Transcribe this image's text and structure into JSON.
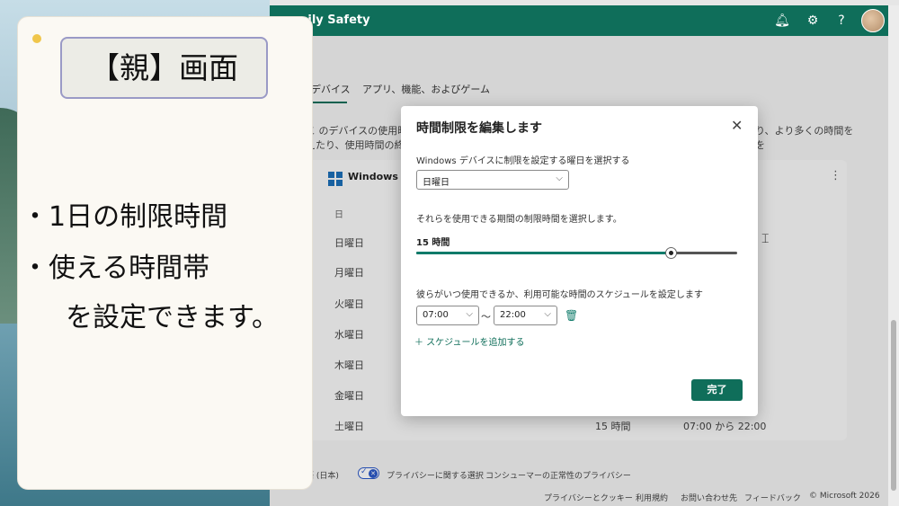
{
  "app": {
    "title": "Microsoft Family Safety",
    "title_visible": "...mily Safety",
    "accent_color": "#0f6e5a",
    "icons": [
      "bell-icon",
      "people-settings-icon",
      "help-icon",
      "avatar"
    ]
  },
  "tabs": [
    {
      "label": "デバイス",
      "active": true
    },
    {
      "label": "アプリ、機能、およびゲーム",
      "active": false
    }
  ],
  "description": {
    "left_line1": "こ のデバイスの使用時",
    "left_line2": "えたり、使用時間の終",
    "right_line1": "り、より多くの時間を",
    "right_line2": "を"
  },
  "device_card": {
    "device_name": "Windows デ",
    "day_header": "日",
    "days": [
      "日曜日",
      "月曜日",
      "火曜日",
      "水曜日",
      "木曜日",
      "金曜日",
      "土曜日"
    ],
    "saturday_hours": "15 時間",
    "saturday_range": "07:00 から 22:00"
  },
  "footer": {
    "locale": "語 (日本)",
    "privacy_choices": "プライバシーに関する選択",
    "consumer_health_privacy": "コンシューマーの正常性のプライバシー",
    "links": [
      "プライバシーとクッキー",
      "利用規約",
      "お問い合わせ先",
      "フィードバック",
      "© Microsoft 2026"
    ]
  },
  "modal": {
    "title": "時間制限を編集します",
    "close_icon": "close-icon",
    "day_prompt": "Windows デバイスに制限を設定する曜日を選択する",
    "day_selected": "日曜日",
    "limit_prompt": "それらを使用できる期間の制限時間を選択します。",
    "limit_value_label": "15 時間",
    "limit_fraction": 0.793,
    "schedule_prompt": "彼らがいつ使用できるか、利用可能な時間のスケジュールを設定します",
    "start_time": "07:00",
    "range_separator": "～",
    "end_time": "22:00",
    "add_schedule": "＋ スケジュールを追加する",
    "done_label": "完了"
  },
  "overlay_note": {
    "title": "【親】画面",
    "line1": "・1日の制限時間",
    "line2": "・使える時間帯",
    "line3": "を設定できます。"
  }
}
